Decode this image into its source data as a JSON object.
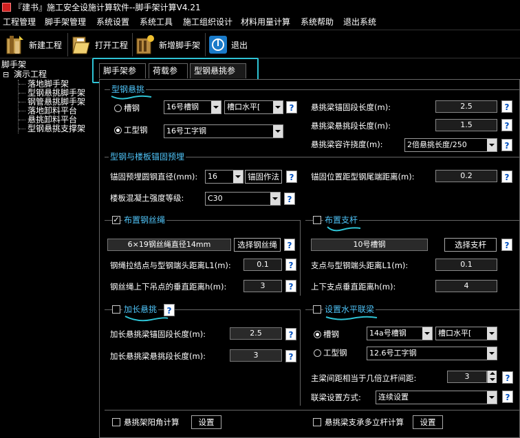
{
  "window": {
    "title": "『建书』施工安全设施计算软件--脚手架计算V4.21"
  },
  "menu": [
    "工程管理",
    "脚手架管理",
    "系统设置",
    "系统工具",
    "施工组织设计",
    "材料用量计算",
    "系统帮助",
    "退出系统"
  ],
  "toolbar": {
    "new": "新建工程",
    "open": "打开工程",
    "add": "新增脚手架",
    "exit": "退出"
  },
  "tree": {
    "root": "脚手架",
    "project": "演示工程",
    "expander": "⊟",
    "items": [
      "落地脚手架",
      "型钢悬挑脚手架",
      "钢管悬挑脚手架",
      "落地卸料平台",
      "悬挑卸料平台",
      "型钢悬挑支撑架"
    ]
  },
  "tabs": [
    "脚手架参数",
    "荷载参数",
    "型钢悬挑参数"
  ],
  "help": "?",
  "section1": {
    "title": "型钢悬挑",
    "radio1": "槽钢",
    "radio1_value": "16号槽钢",
    "radio1_orient": "槽口水平[",
    "radio2": "工型钢",
    "radio2_value": "16号工字钢",
    "anchor_len_label": "悬挑梁锚固段长度(m):",
    "anchor_len": "2.5",
    "cant_len_label": "悬挑梁悬挑段长度(m):",
    "cant_len": "1.5",
    "deflection_label": "悬挑梁容许挠度(m):",
    "deflection": "2倍悬挑长度/250"
  },
  "section2": {
    "title": "型钢与楼板锚固预埋",
    "diam_label": "锚固预埋圆钢直径(mm):",
    "diam": "16",
    "method_btn": "锚固作法",
    "dist_label": "锚固位置距型钢尾端距离(m):",
    "dist": "0.2",
    "concrete_label": "楼板混凝土强度等级:",
    "concrete": "C30"
  },
  "section3": {
    "title": "布置钢丝绳",
    "checked": "✓",
    "rope": "6×19钢丝绳直径14mm",
    "select_btn": "选择钢丝绳",
    "l1_label": "钢绳拉结点与型钢端头距离L1(m):",
    "l1": "0.1",
    "h_label": "钢丝绳上下吊点的垂直距离h(m):",
    "h": "3"
  },
  "section4": {
    "title": "布置支杆",
    "strut": "10号槽钢",
    "select_btn": "选择支杆",
    "l1_label": "支点与型钢端头距离L1(m):",
    "l1": "0.1",
    "h_label": "上下支点垂直距离h(m):",
    "h": "4"
  },
  "section5": {
    "title": "加长悬挑",
    "anchor_label": "加长悬挑梁锚固段长度(m):",
    "anchor": "2.5",
    "cant_label": "加长悬挑梁悬挑段长度(m):",
    "cant": "3"
  },
  "section6": {
    "title": "设置水平联梁",
    "radio1": "槽钢",
    "radio1_value": "14a号槽钢",
    "radio1_orient": "槽口水平[",
    "radio2": "工型钢",
    "radio2_value": "12.6号工字钢",
    "spacing_label": "主梁间距相当于几倍立杆间距:",
    "spacing": "3",
    "mode_label": "联梁设置方式:",
    "mode": "连续设置"
  },
  "bottom": {
    "corner_label": "悬挑架阳角计算",
    "corner_btn": "设置",
    "multi_label": "悬挑梁支承多立杆计算",
    "multi_btn": "设置"
  }
}
